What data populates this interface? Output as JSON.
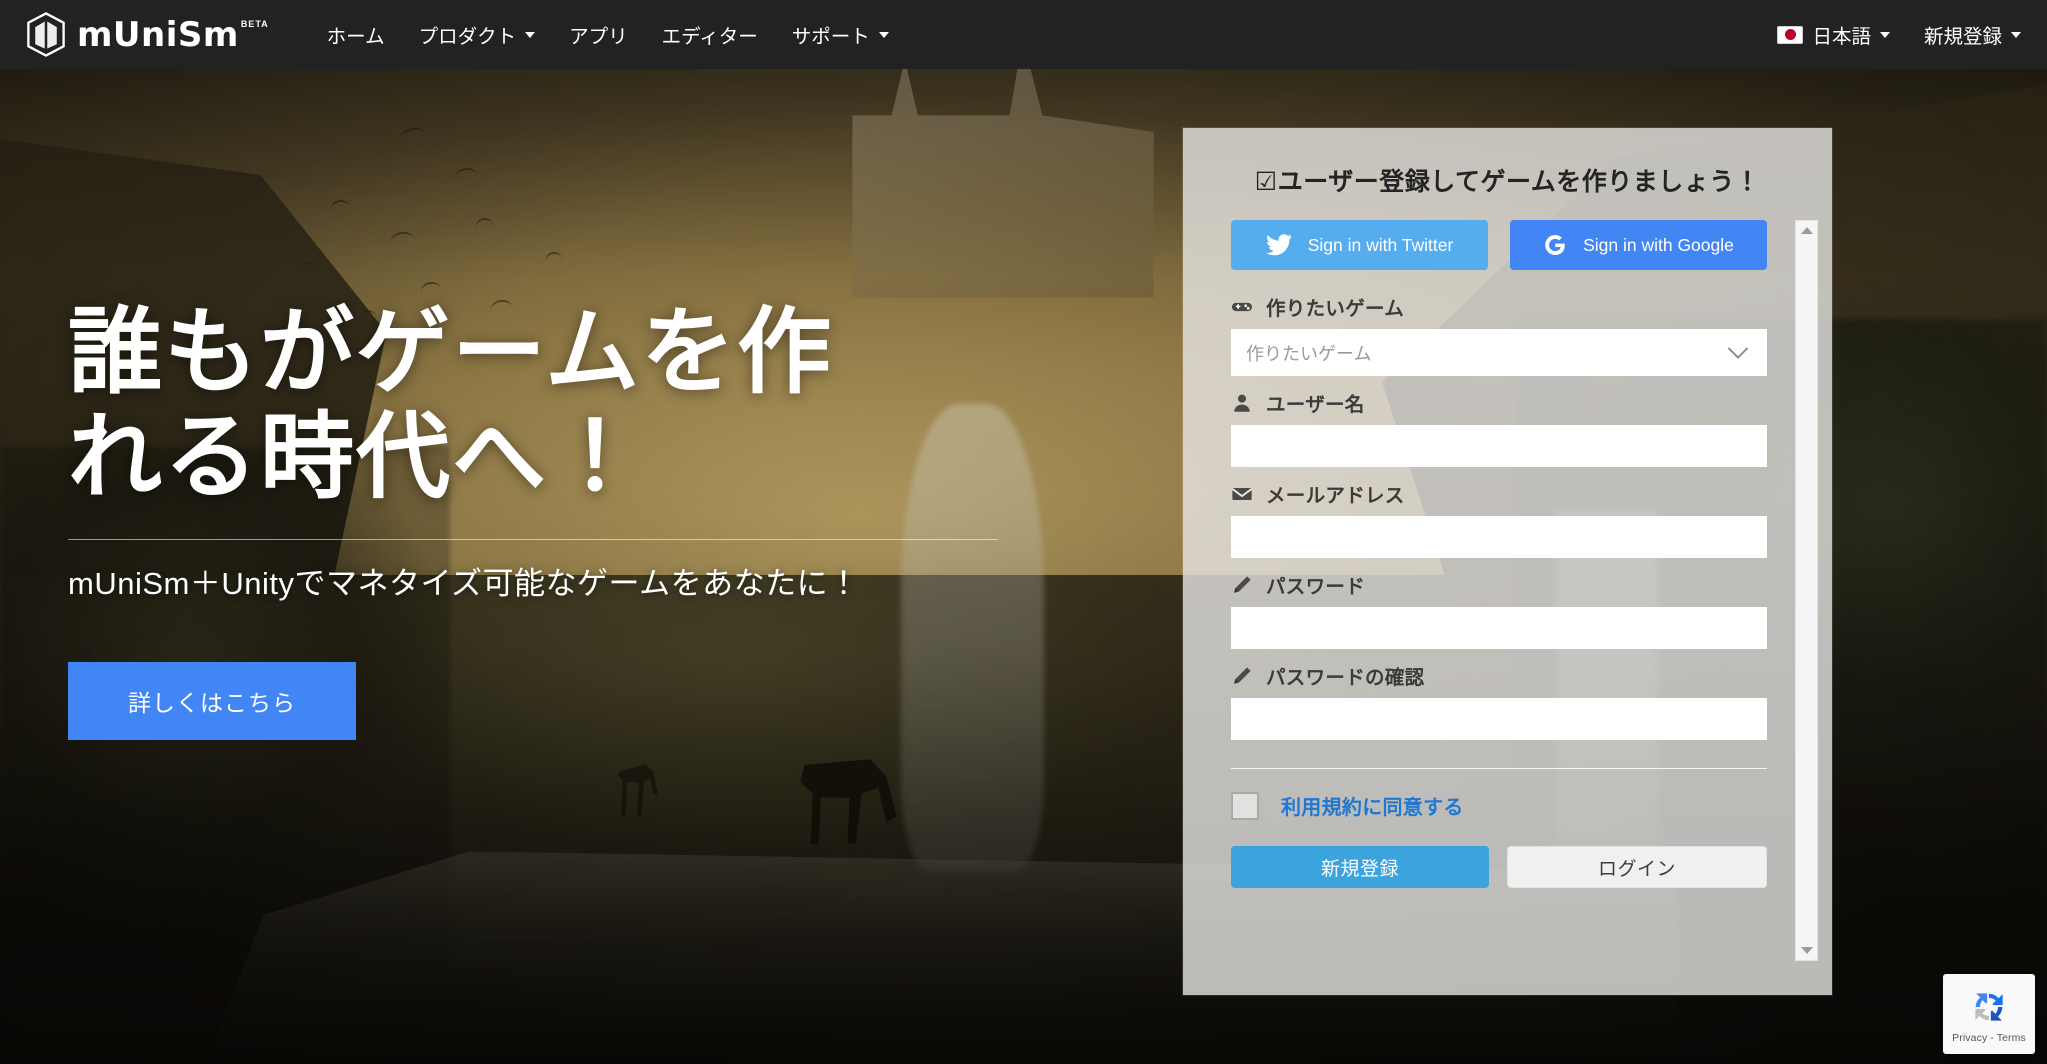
{
  "header": {
    "brand": {
      "name": "mUniSm",
      "badge": "BETA",
      "logo_icon": "hexagon-logo-icon"
    },
    "nav": [
      {
        "label": "ホーム",
        "has_caret": false
      },
      {
        "label": "プロダクト",
        "has_caret": true
      },
      {
        "label": "アプリ",
        "has_caret": false
      },
      {
        "label": "エディター",
        "has_caret": false
      },
      {
        "label": "サポート",
        "has_caret": true
      }
    ],
    "language": {
      "label": "日本語",
      "flag_icon": "japan-flag-icon",
      "has_caret": true
    },
    "account": {
      "label": "新規登録",
      "has_caret": true
    }
  },
  "hero": {
    "heading_line1": "誰もがゲームを作",
    "heading_line2": "れる時代へ！",
    "subtitle": "mUniSm＋Unityでマネタイズ可能なゲームをあなたに！",
    "cta_label": "詳しくはこちら"
  },
  "signup": {
    "title": "☑ユーザー登録してゲームを作りましょう！",
    "social": [
      {
        "label": "Sign in with Twitter",
        "icon": "twitter-bird-icon",
        "color": "#55acee"
      },
      {
        "label": "Sign in with Google",
        "icon": "google-g-icon",
        "color": "#4285f4"
      }
    ],
    "fields": [
      {
        "label": "作りたいゲーム",
        "icon": "gamepad-icon",
        "type": "select",
        "placeholder": "作りたいゲーム",
        "value": ""
      },
      {
        "label": "ユーザー名",
        "icon": "user-icon",
        "type": "text",
        "placeholder": "",
        "value": ""
      },
      {
        "label": "メールアドレス",
        "icon": "envelope-icon",
        "type": "email",
        "placeholder": "",
        "value": ""
      },
      {
        "label": "パスワード",
        "icon": "pencil-icon",
        "type": "password",
        "placeholder": "",
        "value": ""
      },
      {
        "label": "パスワードの確認",
        "icon": "pencil-icon",
        "type": "password",
        "placeholder": "",
        "value": ""
      }
    ],
    "terms": {
      "label": "利用規約に同意する",
      "checked": false,
      "link_color": "#1f78d1"
    },
    "actions": {
      "primary_label": "新規登録",
      "secondary_label": "ログイン",
      "primary_color": "#3ba3dd"
    },
    "scrollbar": {
      "visible": true,
      "position": "top"
    }
  },
  "recaptcha": {
    "text": "Privacy - Terms",
    "icon": "recaptcha-icon"
  }
}
